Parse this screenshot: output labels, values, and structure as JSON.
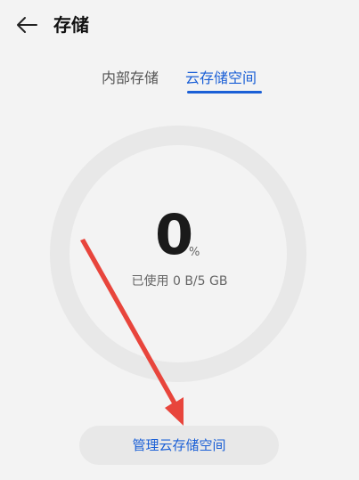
{
  "header": {
    "title": "存储",
    "back_icon": "arrow-left-icon"
  },
  "tabs": [
    {
      "label": "内部存储",
      "selected": false
    },
    {
      "label": "云存储空间",
      "selected": true
    }
  ],
  "usage": {
    "percent_value": "0",
    "percent_unit": "%",
    "used_fraction": 0,
    "label": "已使用 0 B/5 GB"
  },
  "actions": {
    "manage_label": "管理云存储空间"
  },
  "colors": {
    "accent": "#1a5fd6",
    "ring": "#e8e8e8",
    "annotation_arrow": "#e8453c",
    "background": "#f3f3f3"
  }
}
